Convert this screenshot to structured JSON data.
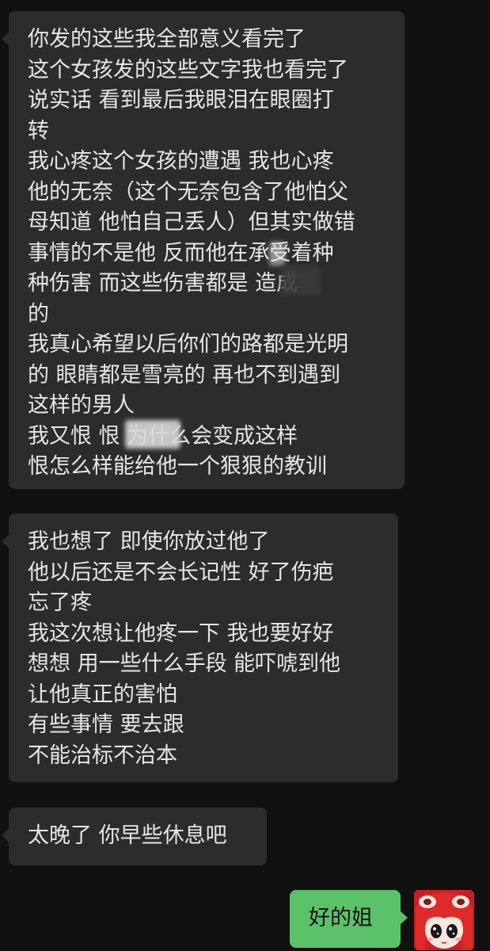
{
  "messages": [
    {
      "side": "left",
      "lines": [
        "你发的这些我全部意义看完了",
        "这个女孩发的这些文字我也看完了",
        "说实话 看到最后我眼泪在眼圈打",
        "转",
        "我心疼这个女孩的遭遇 我也心疼",
        "他的无奈（这个无奈包含了他怕父",
        "母知道 他怕自己丢人）但其实做错",
        "事情的不是他 反而他在承受着种",
        "种伤害 而这些伤害都是       造成",
        "的",
        "我真心希望以后你们的路都是光明",
        "的 眼睛都是雪亮的 再也不到遇到",
        "这样的男人",
        "我又恨 恨         为什么会变成这样",
        "恨怎么样能给他一个狠狠的教训"
      ]
    },
    {
      "side": "left",
      "lines": [
        "我也想了 即使你放过他了",
        "他以后还是不会长记性 好了伤疤",
        "忘了疼",
        "我这次想让他疼一下 我也要好好",
        "想想 用一些什么手段 能吓唬到他",
        "让他真正的害怕",
        "有些事情 要去跟",
        "不能治标不治本"
      ]
    },
    {
      "side": "left",
      "lines": [
        "太晚了 你早些休息吧"
      ]
    },
    {
      "side": "right",
      "lines": [
        "好的姐"
      ]
    }
  ],
  "colors": {
    "background": "#111111",
    "incoming_bubble": "#2c2c2c",
    "outgoing_bubble": "#5bc26a"
  },
  "avatar": {
    "icon": "cartoon-girl-avatar-icon"
  }
}
